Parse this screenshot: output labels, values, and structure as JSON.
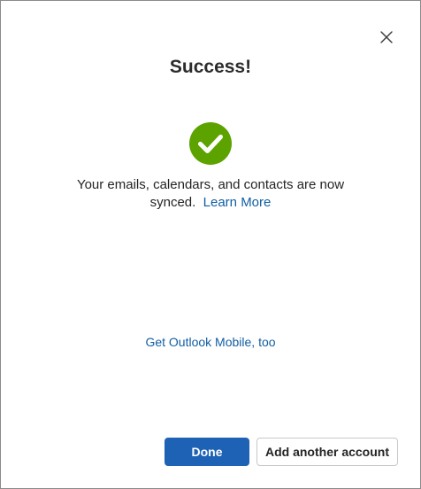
{
  "dialog": {
    "title": "Success!",
    "close_icon": "close-icon",
    "status_icon": "success-checkmark-icon",
    "message_text": "Your emails, calendars, and contacts are now synced.",
    "learn_more_label": "Learn More",
    "mobile_link_label": "Get Outlook Mobile, too",
    "done_label": "Done",
    "add_account_label": "Add another account"
  },
  "colors": {
    "accent": "#1e62b5",
    "link": "#115ea3",
    "success": "#5ca300"
  }
}
